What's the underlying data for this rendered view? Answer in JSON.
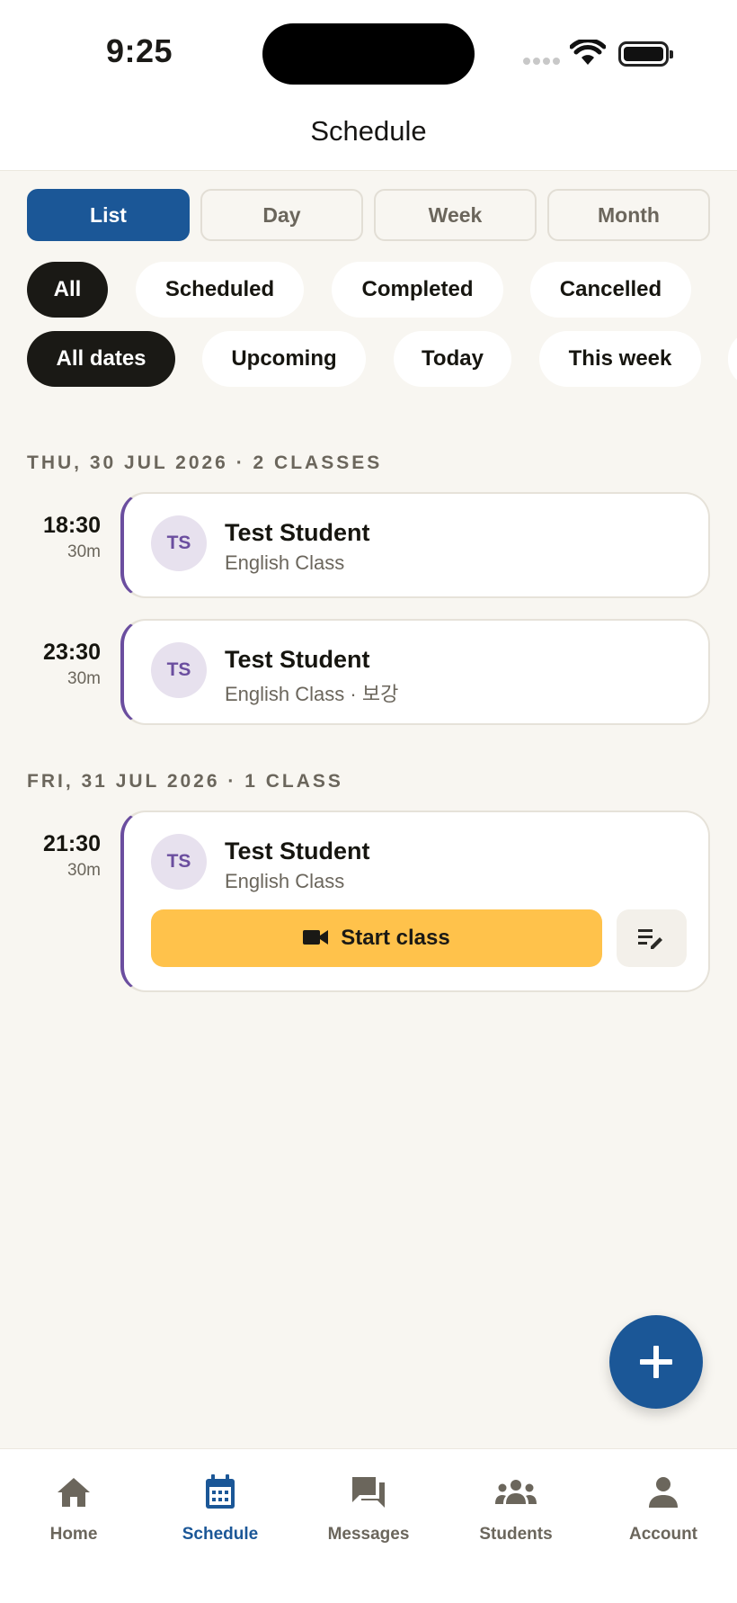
{
  "status_bar": {
    "time": "9:25"
  },
  "header": {
    "title": "Schedule"
  },
  "view_tabs": [
    {
      "label": "List",
      "active": true
    },
    {
      "label": "Day",
      "active": false
    },
    {
      "label": "Week",
      "active": false
    },
    {
      "label": "Month",
      "active": false
    }
  ],
  "status_filters": [
    {
      "label": "All",
      "active": true
    },
    {
      "label": "Scheduled",
      "active": false
    },
    {
      "label": "Completed",
      "active": false
    },
    {
      "label": "Cancelled",
      "active": false
    }
  ],
  "date_filters": [
    {
      "label": "All dates",
      "active": true
    },
    {
      "label": "Upcoming",
      "active": false
    },
    {
      "label": "Today",
      "active": false
    },
    {
      "label": "This week",
      "active": false
    }
  ],
  "sections": [
    {
      "label": "THU, 30 JUL 2026 · 2 CLASSES",
      "classes": [
        {
          "time": "18:30",
          "duration": "30m",
          "initials": "TS",
          "name": "Test Student",
          "subtitle": "English Class"
        },
        {
          "time": "23:30",
          "duration": "30m",
          "initials": "TS",
          "name": "Test Student",
          "subtitle": "English Class · 보강"
        }
      ]
    },
    {
      "label": "FRI, 31 JUL 2026 · 1 CLASS",
      "classes": [
        {
          "time": "21:30",
          "duration": "30m",
          "initials": "TS",
          "name": "Test Student",
          "subtitle": "English Class",
          "start_label": "Start class"
        }
      ]
    }
  ],
  "bottom_nav": [
    {
      "label": "Home",
      "icon": "home-icon",
      "active": false
    },
    {
      "label": "Schedule",
      "icon": "calendar-icon",
      "active": true
    },
    {
      "label": "Messages",
      "icon": "chat-icon",
      "active": false
    },
    {
      "label": "Students",
      "icon": "group-icon",
      "active": false
    },
    {
      "label": "Account",
      "icon": "person-icon",
      "active": false
    }
  ],
  "colors": {
    "primary": "#1B5797",
    "accent_yellow": "#FFC24B",
    "class_accent": "#6B4E9F",
    "background": "#F8F6F1",
    "chip_active": "#1a1915"
  }
}
